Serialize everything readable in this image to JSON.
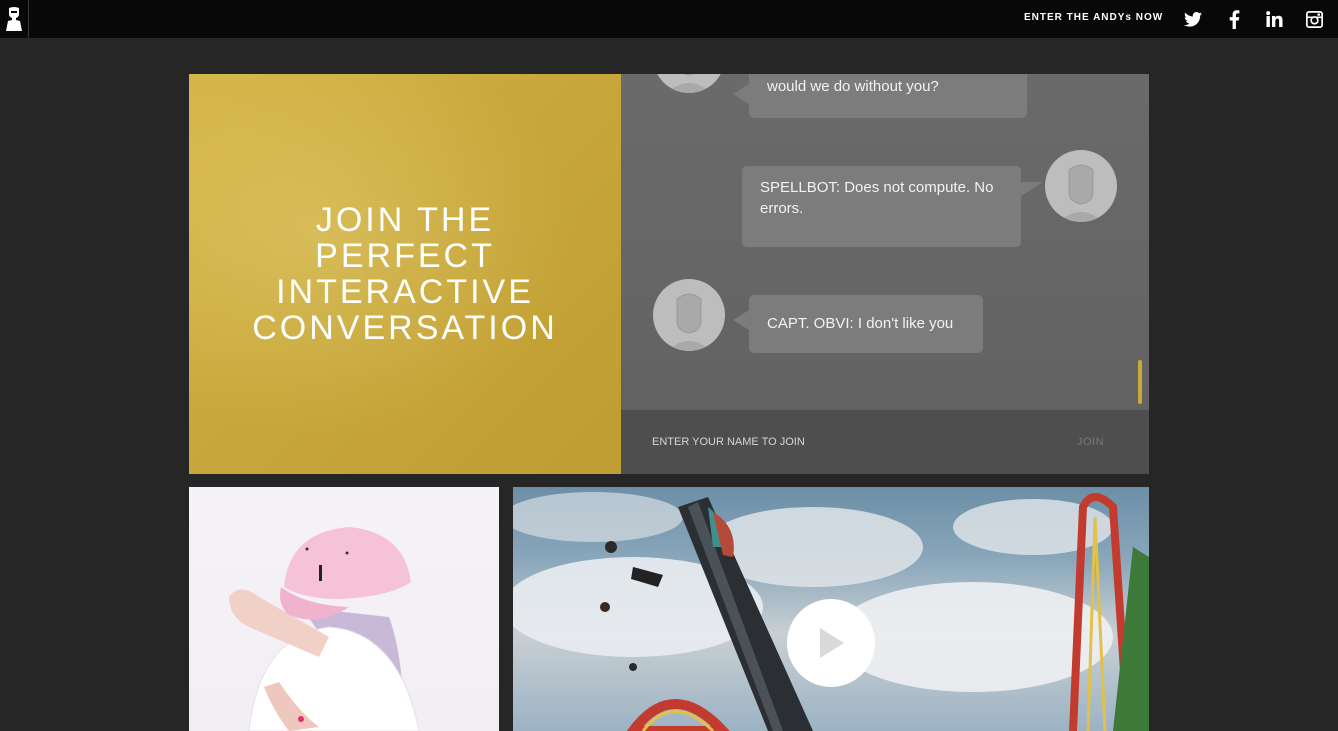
{
  "header": {
    "cta_label": "ENTER THE ANDYs NOW",
    "social": [
      {
        "icon": "twitter-icon"
      },
      {
        "icon": "facebook-icon"
      },
      {
        "icon": "linkedin-icon"
      },
      {
        "icon": "instagram-icon"
      }
    ]
  },
  "hero": {
    "title": "JOIN THE PERFECT INTERACTIVE CONVERSATION"
  },
  "chat": {
    "messages": [
      {
        "side": "left",
        "text": "would we do without you?"
      },
      {
        "side": "right",
        "text": "SPELLBOT: Does not compute. No errors."
      },
      {
        "side": "left",
        "text": "CAPT. OBVI: I don't like you"
      }
    ],
    "input_placeholder": "ENTER YOUR NAME TO JOIN",
    "join_label": "JOIN"
  },
  "colors": {
    "accent_gold": "#c9a93c",
    "background": "#262626",
    "topbar": "#080808"
  }
}
